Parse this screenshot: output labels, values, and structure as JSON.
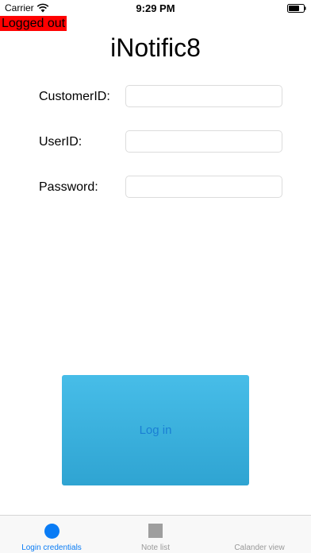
{
  "status_bar": {
    "carrier": "Carrier",
    "time": "9:29 PM"
  },
  "badge": {
    "text": "Logged out",
    "color": "#ff0000"
  },
  "title": "iNotific8",
  "form": {
    "customer_id_label": "CustomerID:",
    "customer_id_value": "",
    "user_id_label": "UserID:",
    "user_id_value": "",
    "password_label": "Password:",
    "password_value": ""
  },
  "login_button": {
    "label": "Log in"
  },
  "tabs": [
    {
      "label": "Login credentials",
      "icon": "circle-icon",
      "active": true
    },
    {
      "label": "Note list",
      "icon": "square-icon",
      "active": false
    },
    {
      "label": "Calander view",
      "icon": "none",
      "active": false
    }
  ],
  "colors": {
    "accent": "#0a7cf5",
    "button_top": "#47bde8",
    "button_bottom": "#2fa4d2"
  }
}
